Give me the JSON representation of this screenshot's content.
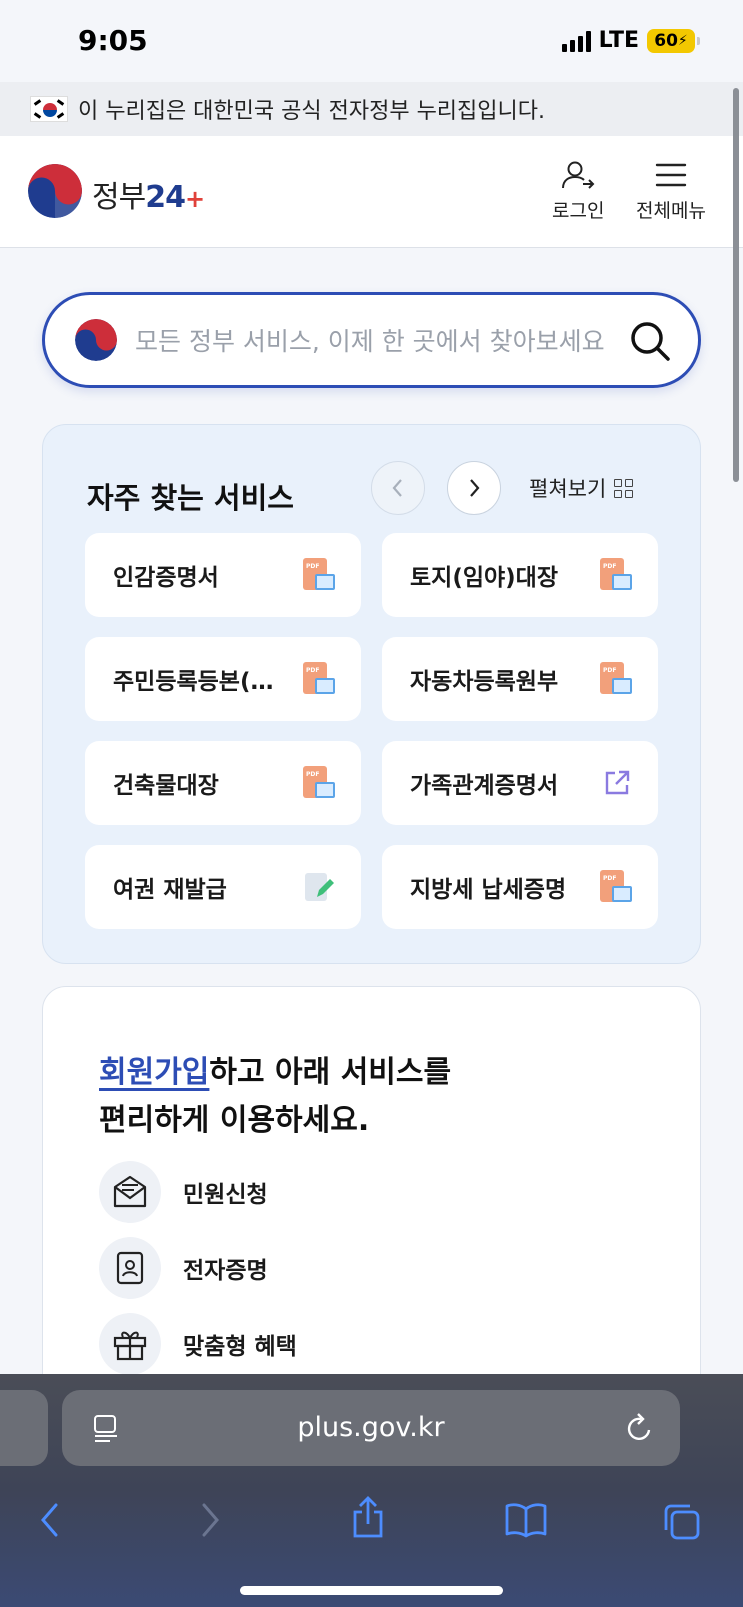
{
  "status_bar": {
    "time": "9:05",
    "network": "LTE",
    "battery": "60"
  },
  "gov_banner": {
    "text": "이 누리집은 대한민국 공식 전자정부 누리집입니다."
  },
  "header": {
    "logo_text": "정부",
    "logo_number": "24",
    "login_label": "로그인",
    "menu_label": "전체메뉴"
  },
  "search": {
    "placeholder": "모든 정부 서비스, 이제 한 곳에서 찾아보세요",
    "value": ""
  },
  "frequent_services": {
    "title": "자주 찾는 서비스",
    "expand_label": "펼쳐보기",
    "items": [
      {
        "label": "인감증명서",
        "icon": "pdf-icon"
      },
      {
        "label": "토지(임야)대장",
        "icon": "pdf-icon"
      },
      {
        "label": "주민등록등본(…",
        "icon": "pdf-icon"
      },
      {
        "label": "자동차등록원부",
        "icon": "pdf-icon"
      },
      {
        "label": "건축물대장",
        "icon": "pdf-icon"
      },
      {
        "label": "가족관계증명서",
        "icon": "external-link-icon"
      },
      {
        "label": "여권 재발급",
        "icon": "edit-document-icon"
      },
      {
        "label": "지방세 납세증명",
        "icon": "pdf-icon"
      }
    ]
  },
  "signup": {
    "link_text": "회원가입",
    "heading_rest": "하고 아래 서비스를",
    "heading_line2": "편리하게 이용하세요.",
    "benefits": [
      {
        "label": "민원신청",
        "icon": "envelope-icon"
      },
      {
        "label": "전자증명",
        "icon": "id-card-icon"
      },
      {
        "label": "맞춤형 혜택",
        "icon": "gift-icon"
      }
    ]
  },
  "browser": {
    "url": "plus.gov.kr"
  },
  "colors": {
    "brand_blue": "#2d4db5",
    "panel_bg": "#e9f1fb",
    "pdf_orange": "#f2a07b"
  }
}
